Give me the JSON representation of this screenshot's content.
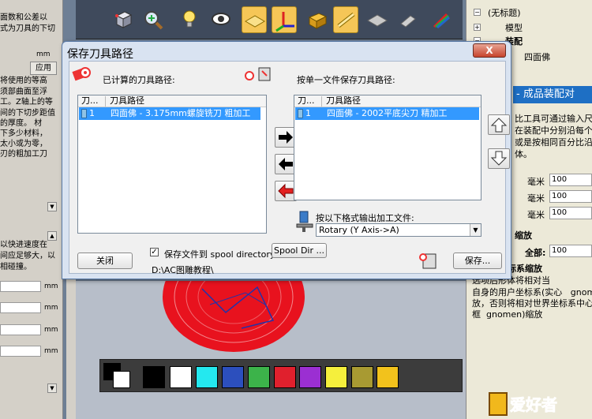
{
  "left_panel": {
    "lines_top": [
      "面数和公差以",
      "式为刀具的下切"
    ],
    "mm_label": "mm",
    "apply_button": "应用",
    "lines_mid": [
      "将使用的等高",
      "须部曲面至浮",
      "工。Z轴上的等",
      "间的下切步距值",
      "的厚度。 材",
      "下多少材料，",
      "太小或为零，",
      "刃的粗加工刀"
    ],
    "lines_low": [
      "以快进速度在",
      "间应足够大，以",
      "相碰撞。"
    ],
    "unit_mm": "mm"
  },
  "toolbar": {
    "icons": [
      "cube-icon",
      "zoom-icon",
      "lightbulb-icon",
      "eye-icon",
      "plane-icon",
      "axis-icon",
      "toolbox-icon",
      "pencil-icon",
      "surface-icon",
      "cutter-icon",
      "brush-icon"
    ]
  },
  "tree": {
    "items": [
      {
        "label": "(无标题)"
      },
      {
        "label": "模型"
      },
      {
        "label": "装配"
      },
      {
        "label": "四面佛"
      }
    ]
  },
  "right_panel": {
    "header": "- 成品装配对",
    "desc_lines": [
      "比工具可通过输入尺",
      "在装配中分别沿每个",
      "或是按相同百分比沿",
      "体。"
    ],
    "unit": "毫米",
    "field_values": [
      "100",
      "100",
      "100"
    ],
    "scale_label": "缩放",
    "all_label": "全部:",
    "all_value": "100",
    "user_coord_title": "用户坐标系缩放",
    "bottom_lines": [
      "选项后形体将相对当",
      "自身的用户坐标系(实心   gnomo",
      "放，否则将相对世界坐标系中心",
      "框  gnomen)缩放"
    ]
  },
  "dialog": {
    "title": "保存刀具路径",
    "computed_label": "已计算的刀具路径:",
    "save_single_label": "按单一文件保存刀具路径:",
    "col_tool": "刀...",
    "col_path": "刀具路径",
    "left_rows": [
      {
        "num": "1",
        "name": "四面佛 - 3.175mm螺旋铣刀 粗加工"
      }
    ],
    "right_rows": [
      {
        "num": "1",
        "name": "四面佛 - 2002平底尖刀 精加工"
      }
    ],
    "format_label": "按以下格式输出加工文件:",
    "format_value": "Rotary (Y Axis->A)",
    "close_button": "关闭",
    "spool_checkbox_label": "保存文件到 spool directory",
    "spool_checked": true,
    "spool_dir_button": "Spool Dir ...",
    "path_text": "D:\\AC图雕教程\\",
    "save_button": "保存...",
    "close_x": "X"
  },
  "palette": {
    "colors": [
      "#000000",
      "#ffffff",
      "#24e8ef",
      "#2c4fbd",
      "#3cb34a",
      "#e0202d",
      "#9b2fd2",
      "#f5ef3c",
      "#a89a32",
      "#f2c21c"
    ]
  },
  "watermark": {
    "text": "爱好者"
  }
}
